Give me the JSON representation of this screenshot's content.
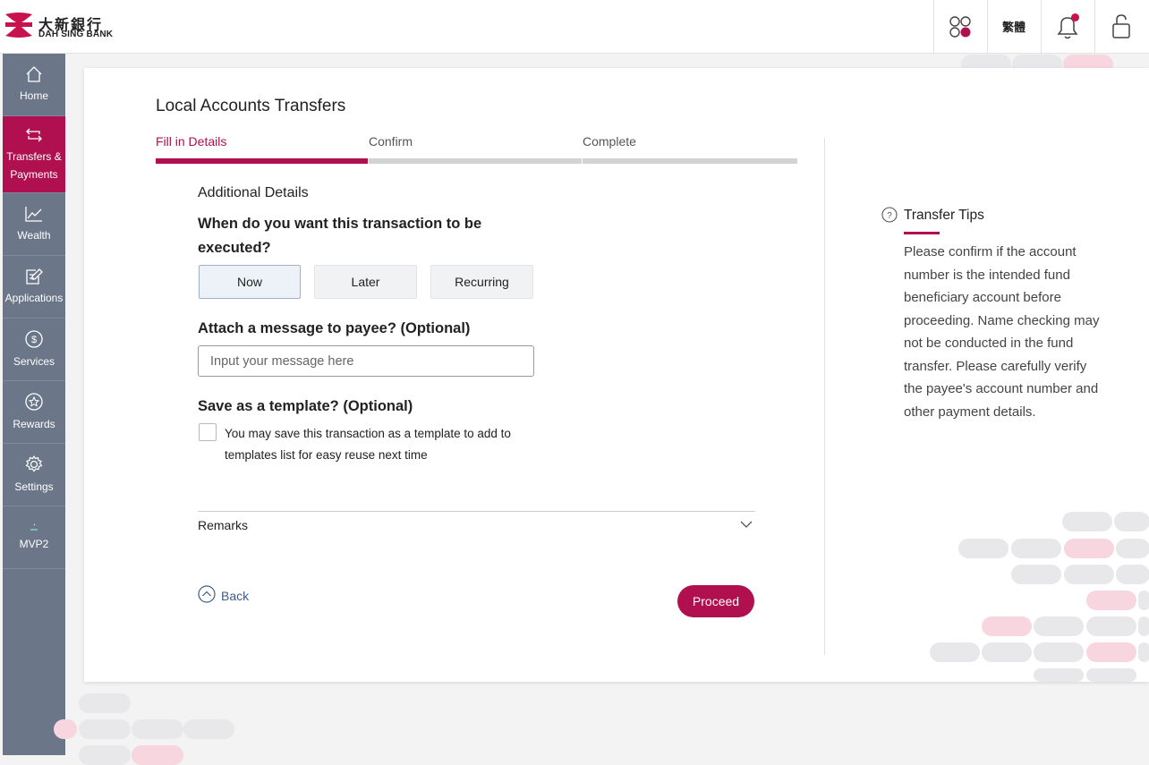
{
  "header": {
    "logo_zh": "大新銀行",
    "logo_en": "DAH SING BANK",
    "language_label": "繁體"
  },
  "sidebar": {
    "items": [
      {
        "label": "Home",
        "icon": "home-icon"
      },
      {
        "label": "Transfers & Payments",
        "icon": "transfer-icon",
        "active": true
      },
      {
        "label": "Wealth",
        "icon": "chart-icon"
      },
      {
        "label": "Applications",
        "icon": "edit-form-icon"
      },
      {
        "label": "Services",
        "icon": "dollar-icon"
      },
      {
        "label": "Rewards",
        "icon": "star-icon"
      },
      {
        "label": "Settings",
        "icon": "gear-icon"
      },
      {
        "label": "MVP2",
        "icon": "small-bar-icon"
      }
    ]
  },
  "page": {
    "title": "Local Accounts Transfers",
    "steps": [
      "Fill in Details",
      "Confirm",
      "Complete"
    ],
    "active_step": 0,
    "section_title": "Additional Details",
    "when_question": "When do you want this transaction to be executed?",
    "when_options": [
      "Now",
      "Later",
      "Recurring"
    ],
    "selected_option": "Now",
    "message_question": "Attach a message to payee? (Optional)",
    "message_placeholder": "Input your message here",
    "template_question": "Save as a template? (Optional)",
    "template_checkbox_text": "You may save this transaction as a template to add to templates list for easy reuse next time",
    "remarks_label": "Remarks",
    "back_label": "Back",
    "proceed_label": "Proceed"
  },
  "tips": {
    "title": "Transfer Tips",
    "body": "Please confirm if the account number is the intended fund beneficiary account before proceeding. Name checking may not be conducted in the fund transfer. Please carefully verify the payee's account number and other payment details."
  },
  "colors": {
    "brand": "#b0104f",
    "sidebar": "#6b7789",
    "link": "#3e5c8a"
  }
}
